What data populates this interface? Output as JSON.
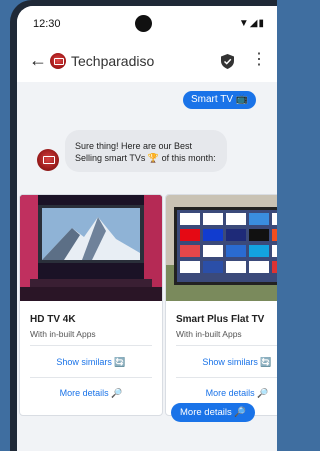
{
  "status_bar": {
    "time": "12:30",
    "icons": "▼◢▮"
  },
  "app_bar": {
    "back_icon": "←",
    "title": "Techparadiso",
    "menu_icon": "⋮"
  },
  "chat": {
    "user_message": "Smart TV 📺",
    "bot_message": "Sure thing! Here are our Best Selling smart TVs 🏆 of this month:",
    "bottom_action": "More details 🔎"
  },
  "products": [
    {
      "title": "HD TV 4K",
      "subtitle": "With in-built Apps",
      "similar": "Show similars 🔄",
      "details": "More details 🔎"
    },
    {
      "title": "Smart Plus Flat TV",
      "subtitle": "With in-built Apps",
      "similar": "Show similars 🔄",
      "details": "More details 🔎"
    }
  ],
  "colors": {
    "accent": "#1a73e8",
    "background": "#3f6ea0",
    "brand": "#b52222"
  }
}
